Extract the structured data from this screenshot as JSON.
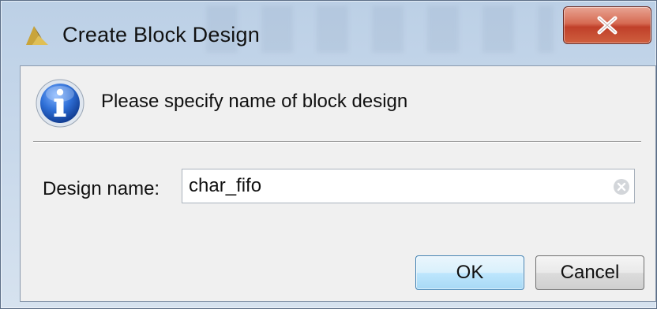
{
  "window": {
    "title": "Create Block Design",
    "close_glyph": "X"
  },
  "dialog": {
    "message": "Please specify name of block design",
    "design_name_label": "Design name:",
    "design_name_value": "char_fifo"
  },
  "buttons": {
    "ok_label": "OK",
    "cancel_label": "Cancel"
  },
  "icons": {
    "app": "vivado-logo-icon",
    "info": "info-icon",
    "clear": "clear-input-icon",
    "close": "close-icon"
  },
  "colors": {
    "info_blue": "#1f5fbf",
    "close_red": "#c0402a",
    "ok_border": "#3c7fb1"
  }
}
